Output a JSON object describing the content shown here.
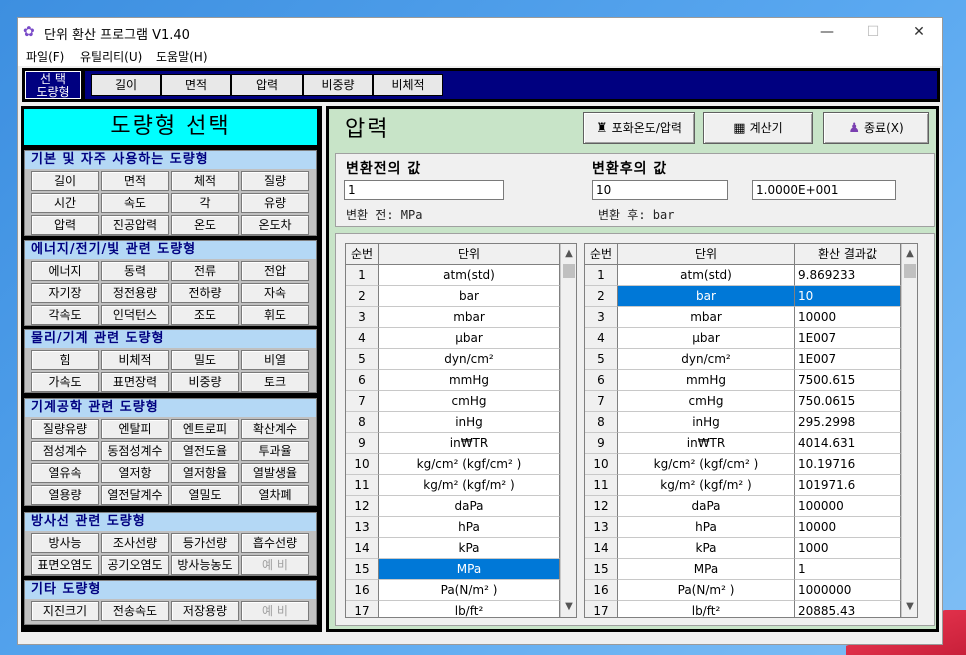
{
  "window": {
    "title": "단위 환산 프로그램 V1.40",
    "minimize": "—",
    "maximize": "☐",
    "close": "✕"
  },
  "menu": [
    "파일(F)",
    "유틸리티(U)",
    "도움말(H)"
  ],
  "selector": {
    "line1": "선 택",
    "line2": "도량형"
  },
  "top_tabs": [
    "길이",
    "면적",
    "압력",
    "비중량",
    "비체적"
  ],
  "left_title": "도량형 선택",
  "groups": [
    {
      "title": "기본 및 자주 사용하는 도량형",
      "buttons": [
        "길이",
        "면적",
        "체적",
        "질량",
        "시간",
        "속도",
        "각",
        "유량",
        "압력",
        "진공압력",
        "온도",
        "온도차"
      ]
    },
    {
      "title": "에너지/전기/빛 관련 도량형",
      "buttons": [
        "에너지",
        "동력",
        "전류",
        "전압",
        "자기장",
        "정전용량",
        "전하량",
        "자속",
        "각속도",
        "인덕턴스",
        "조도",
        "휘도"
      ]
    },
    {
      "title": "물리/기계 관련 도량형",
      "buttons": [
        "힘",
        "비체적",
        "밀도",
        "비열",
        "가속도",
        "표면장력",
        "비중량",
        "토크"
      ]
    },
    {
      "title": "기계공학 관련 도량형",
      "buttons": [
        "질량유량",
        "엔탈피",
        "엔트로피",
        "확산계수",
        "점성계수",
        "동점성계수",
        "열전도율",
        "투과율",
        "열유속",
        "열저항",
        "열저항율",
        "열발생율",
        "열용량",
        "열전달계수",
        "열밀도",
        "열차폐"
      ]
    },
    {
      "title": "방사선 관련 도량형",
      "buttons": [
        "방사능",
        "조사선량",
        "등가선량",
        "흡수선량",
        "표면오염도",
        "공기오염도",
        "방사능농도",
        "예 비"
      ]
    },
    {
      "title": "기타 도량형",
      "buttons": [
        "지진크기",
        "전송속도",
        "저장용량",
        "예 비"
      ]
    }
  ],
  "right_title": "압력",
  "action_buttons": {
    "saturation": "포화온도/압력",
    "calculator": "계산기",
    "exit": "종료(X)"
  },
  "conversion": {
    "before_label": "변환전의 값",
    "after_label": "변환후의 값",
    "before_value": "1",
    "after_value": "10",
    "after_sci": "1.0000E+001",
    "before_unit": "변환 전: MPa",
    "after_unit": "변환 후: bar"
  },
  "left_table": {
    "headers": [
      "순번",
      "단위"
    ],
    "rows": [
      [
        "1",
        "atm(std)"
      ],
      [
        "2",
        "bar"
      ],
      [
        "3",
        "mbar"
      ],
      [
        "4",
        "μbar"
      ],
      [
        "5",
        "dyn/cm²"
      ],
      [
        "6",
        "mmHg"
      ],
      [
        "7",
        "cmHg"
      ],
      [
        "8",
        "inHg"
      ],
      [
        "9",
        "in₩TR"
      ],
      [
        "10",
        "kg/cm² (kgf/cm² )"
      ],
      [
        "11",
        "kg/m² (kgf/m² )"
      ],
      [
        "12",
        "daPa"
      ],
      [
        "13",
        "hPa"
      ],
      [
        "14",
        "kPa"
      ],
      [
        "15",
        "MPa"
      ],
      [
        "16",
        "Pa(N/m² )"
      ],
      [
        "17",
        "lb/ft²"
      ]
    ],
    "selected_row": 15
  },
  "right_table": {
    "headers": [
      "순번",
      "단위",
      "환산 결과값"
    ],
    "rows": [
      [
        "1",
        "atm(std)",
        "9.869233"
      ],
      [
        "2",
        "bar",
        "10"
      ],
      [
        "3",
        "mbar",
        "10000"
      ],
      [
        "4",
        "μbar",
        "1E007"
      ],
      [
        "5",
        "dyn/cm²",
        "1E007"
      ],
      [
        "6",
        "mmHg",
        "7500.615"
      ],
      [
        "7",
        "cmHg",
        "750.0615"
      ],
      [
        "8",
        "inHg",
        "295.2998"
      ],
      [
        "9",
        "in₩TR",
        "4014.631"
      ],
      [
        "10",
        "kg/cm² (kgf/cm² )",
        "10.19716"
      ],
      [
        "11",
        "kg/m² (kgf/m² )",
        "101971.6"
      ],
      [
        "12",
        "daPa",
        "100000"
      ],
      [
        "13",
        "hPa",
        "10000"
      ],
      [
        "14",
        "kPa",
        "1000"
      ],
      [
        "15",
        "MPa",
        "1"
      ],
      [
        "16",
        "Pa(N/m² )",
        "1000000"
      ],
      [
        "17",
        "lb/ft²",
        "20885.43"
      ]
    ],
    "selected_row": 2
  }
}
